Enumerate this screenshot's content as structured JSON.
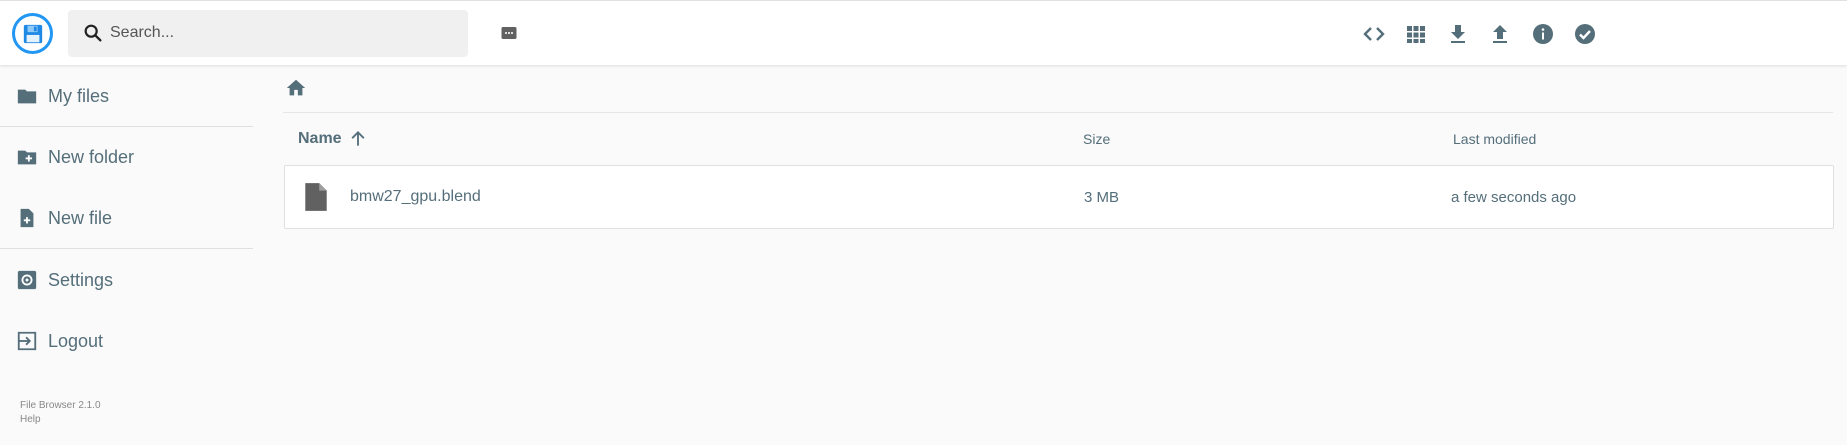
{
  "app": {
    "logo_icon": "floppy-disk-icon",
    "accent_color": "#2196f3"
  },
  "search": {
    "placeholder": "Search...",
    "value": "",
    "icon": "search-icon",
    "options_icon": "search-options-icon"
  },
  "header_actions": [
    {
      "name": "code-view-icon"
    },
    {
      "name": "grid-view-icon"
    },
    {
      "name": "download-icon"
    },
    {
      "name": "upload-icon"
    },
    {
      "name": "info-icon"
    },
    {
      "name": "select-all-check-icon"
    }
  ],
  "sidebar": {
    "items": [
      {
        "label": "My files",
        "icon": "folder-icon"
      },
      {
        "label": "New folder",
        "icon": "new-folder-icon"
      },
      {
        "label": "New file",
        "icon": "new-file-icon"
      },
      {
        "label": "Settings",
        "icon": "settings-icon"
      },
      {
        "label": "Logout",
        "icon": "logout-icon"
      }
    ],
    "version": "File Browser 2.1.0",
    "help": "Help"
  },
  "breadcrumb": {
    "home_icon": "home-icon"
  },
  "listing": {
    "columns": {
      "name": "Name",
      "size": "Size",
      "modified": "Last modified"
    },
    "sort": {
      "column": "name",
      "direction": "ascending"
    },
    "rows": [
      {
        "name": "bmw27_gpu.blend",
        "size": "3 MB",
        "modified": "a few seconds ago",
        "icon": "file-icon"
      }
    ]
  }
}
